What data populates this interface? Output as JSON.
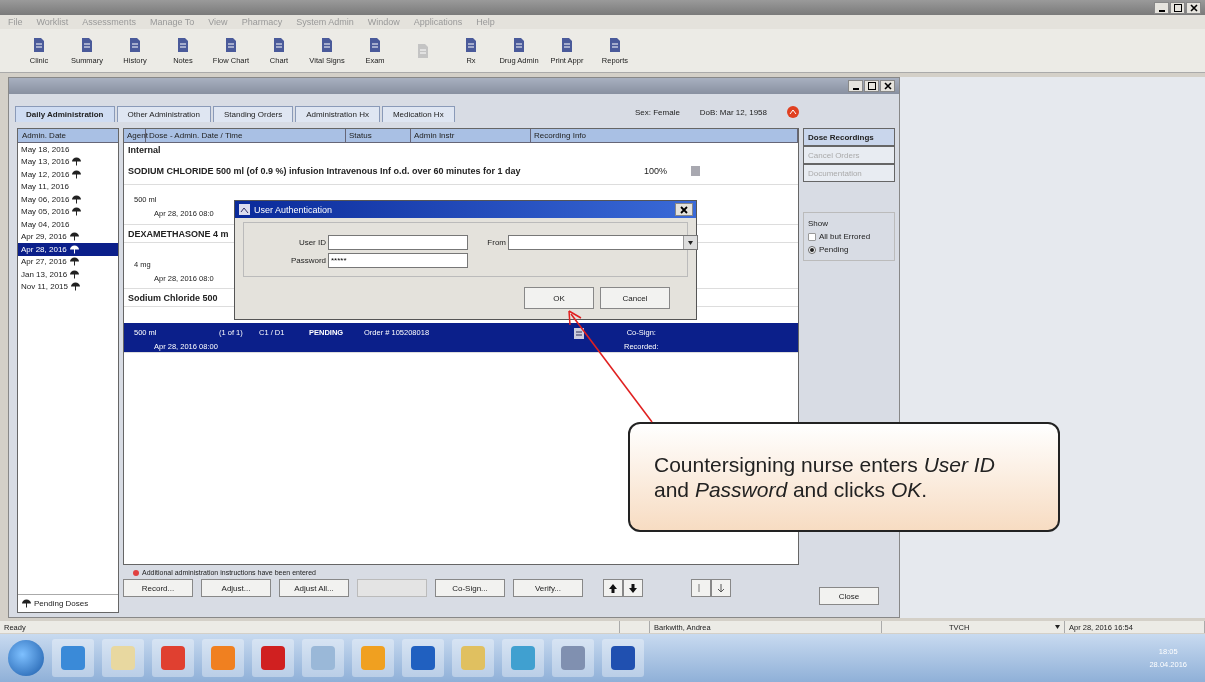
{
  "menu": [
    "File",
    "Worklist",
    "Assessments",
    "Manage To",
    "View",
    "Pharmacy",
    "System Admin",
    "Window",
    "Applications",
    "Help"
  ],
  "toolbar": [
    {
      "label": "Clinic",
      "disabled": false
    },
    {
      "label": "Summary",
      "disabled": false
    },
    {
      "label": "History",
      "disabled": false
    },
    {
      "label": "Notes",
      "disabled": false
    },
    {
      "label": "Flow Chart",
      "disabled": false
    },
    {
      "label": "Chart",
      "disabled": false
    },
    {
      "label": "Vital Signs",
      "disabled": false
    },
    {
      "label": "Exam",
      "disabled": false
    },
    {
      "disabled": true
    },
    {
      "label": "Rx",
      "disabled": false
    },
    {
      "label": "Drug Admin",
      "disabled": false
    },
    {
      "label": "Print Appr",
      "disabled": false
    },
    {
      "label": "Reports",
      "disabled": false
    }
  ],
  "tabs": [
    {
      "label": "Daily Administration",
      "selected": true
    },
    {
      "label": "Other Administration",
      "selected": false
    },
    {
      "label": "Standing Orders",
      "selected": false
    },
    {
      "label": "Administration Hx",
      "selected": false
    },
    {
      "label": "Medication Hx",
      "selected": false
    }
  ],
  "patient": {
    "sex": "Sex: Female",
    "dob": "DoB: Mar 12, 1958"
  },
  "admin_dates": {
    "header": "Admin. Date",
    "legend": "Pending Doses",
    "items": [
      {
        "date": "May 18, 2016",
        "pending": false,
        "selected": false
      },
      {
        "date": "May 13, 2016",
        "pending": true,
        "selected": false
      },
      {
        "date": "May 12, 2016",
        "pending": true,
        "selected": false
      },
      {
        "date": "May 11, 2016",
        "pending": false,
        "selected": false
      },
      {
        "date": "May 06, 2016",
        "pending": true,
        "selected": false
      },
      {
        "date": "May 05, 2016",
        "pending": true,
        "selected": false
      },
      {
        "date": "May 04, 2016",
        "pending": false,
        "selected": false
      },
      {
        "date": "Apr 29, 2016",
        "pending": true,
        "selected": false
      },
      {
        "date": "Apr 28, 2016",
        "pending": true,
        "selected": true
      },
      {
        "date": "Apr 27, 2016",
        "pending": true,
        "selected": false
      },
      {
        "date": "Jan 13, 2016",
        "pending": true,
        "selected": false
      },
      {
        "date": "Nov 11, 2015",
        "pending": true,
        "selected": false
      }
    ]
  },
  "table": {
    "columns": [
      "Agent",
      "Dose - Admin. Date / Time",
      "Status",
      "Admin Instr",
      "Recording Info"
    ],
    "rows": [
      {
        "kind": "group",
        "text": "Internal",
        "selected": false
      },
      {
        "kind": "order",
        "text": "SODIUM CHLORIDE 500 ml (of 0.9 %) infusion Intravenous Inf o.d. over 60 minutes for 1 day",
        "recording": "100%",
        "selected": false
      },
      {
        "kind": "dose",
        "amount": "500 ml",
        "time": "Apr 28, 2016 08:0",
        "selected": false
      },
      {
        "kind": "order",
        "text": "DEXAMETHASONE 4 m",
        "selected": false
      },
      {
        "kind": "dose",
        "amount": "4 mg",
        "time": "Apr 28, 2016 08:0",
        "selected": false
      },
      {
        "kind": "order",
        "text": "Sodium Chloride 500",
        "selected": false
      },
      {
        "kind": "dose",
        "amount": "500 ml",
        "time": "Apr 28, 2016 08:00",
        "count": "(1 of 1)",
        "code": "C1 / D1",
        "status": "PENDING",
        "order": "Order # 105208018",
        "cosign": "Co-Sign:",
        "recorded": "Recorded:",
        "selected": true
      }
    ]
  },
  "right_panel": {
    "tabs": [
      {
        "label": "Dose Recordings",
        "selected": true,
        "disabled": false
      },
      {
        "label": "Cancel Orders",
        "selected": false,
        "disabled": true
      },
      {
        "label": "Documentation",
        "selected": false,
        "disabled": true
      }
    ],
    "show": {
      "label": "Show",
      "options": [
        {
          "label": "All but Errored",
          "selected": false
        },
        {
          "label": "Pending",
          "selected": true
        }
      ]
    }
  },
  "bottom": {
    "note": "Additional administration instructions have been entered",
    "buttons": [
      {
        "kind": "text",
        "label": "Record...",
        "disabled": false
      },
      {
        "kind": "text",
        "label": "Adjust...",
        "disabled": false
      },
      {
        "kind": "text",
        "label": "Adjust All...",
        "disabled": false
      },
      {
        "kind": "text",
        "disabled": true
      },
      {
        "kind": "text",
        "label": "Co-Sign...",
        "disabled": false
      },
      {
        "kind": "text",
        "label": "Verify...",
        "disabled": false
      },
      {
        "kind": "arrows"
      },
      {
        "kind": "pager"
      }
    ],
    "close": "Close"
  },
  "dialog": {
    "title": "User Authentication",
    "user_id_label": "User ID",
    "password_label": "Password",
    "password_value": "*****",
    "from_label": "From",
    "buttons": [
      "OK",
      "Cancel"
    ]
  },
  "callout": {
    "text": "Countersigning nurse enters *User ID* and *Password* and clicks *OK*."
  },
  "status_bar": {
    "text": "Ready",
    "user": "Barkwith, Andrea",
    "location": "TVCH",
    "datetime": "Apr 28, 2016 16:54"
  },
  "taskbar": {
    "apps": [
      {
        "color": "#3a8ad8"
      },
      {
        "color": "#e8d8a0"
      },
      {
        "color": "#e04030"
      },
      {
        "color": "#f08020"
      },
      {
        "color": "#d02020"
      },
      {
        "color": "#9ab8d8"
      },
      {
        "color": "#f0a020"
      },
      {
        "color": "#2060c0"
      },
      {
        "color": "#e0c060"
      },
      {
        "color": "#40a0d0"
      },
      {
        "color": "#8090b0"
      },
      {
        "color": "#2050b0"
      }
    ],
    "time": "18:05",
    "date": "28.04.2016"
  }
}
